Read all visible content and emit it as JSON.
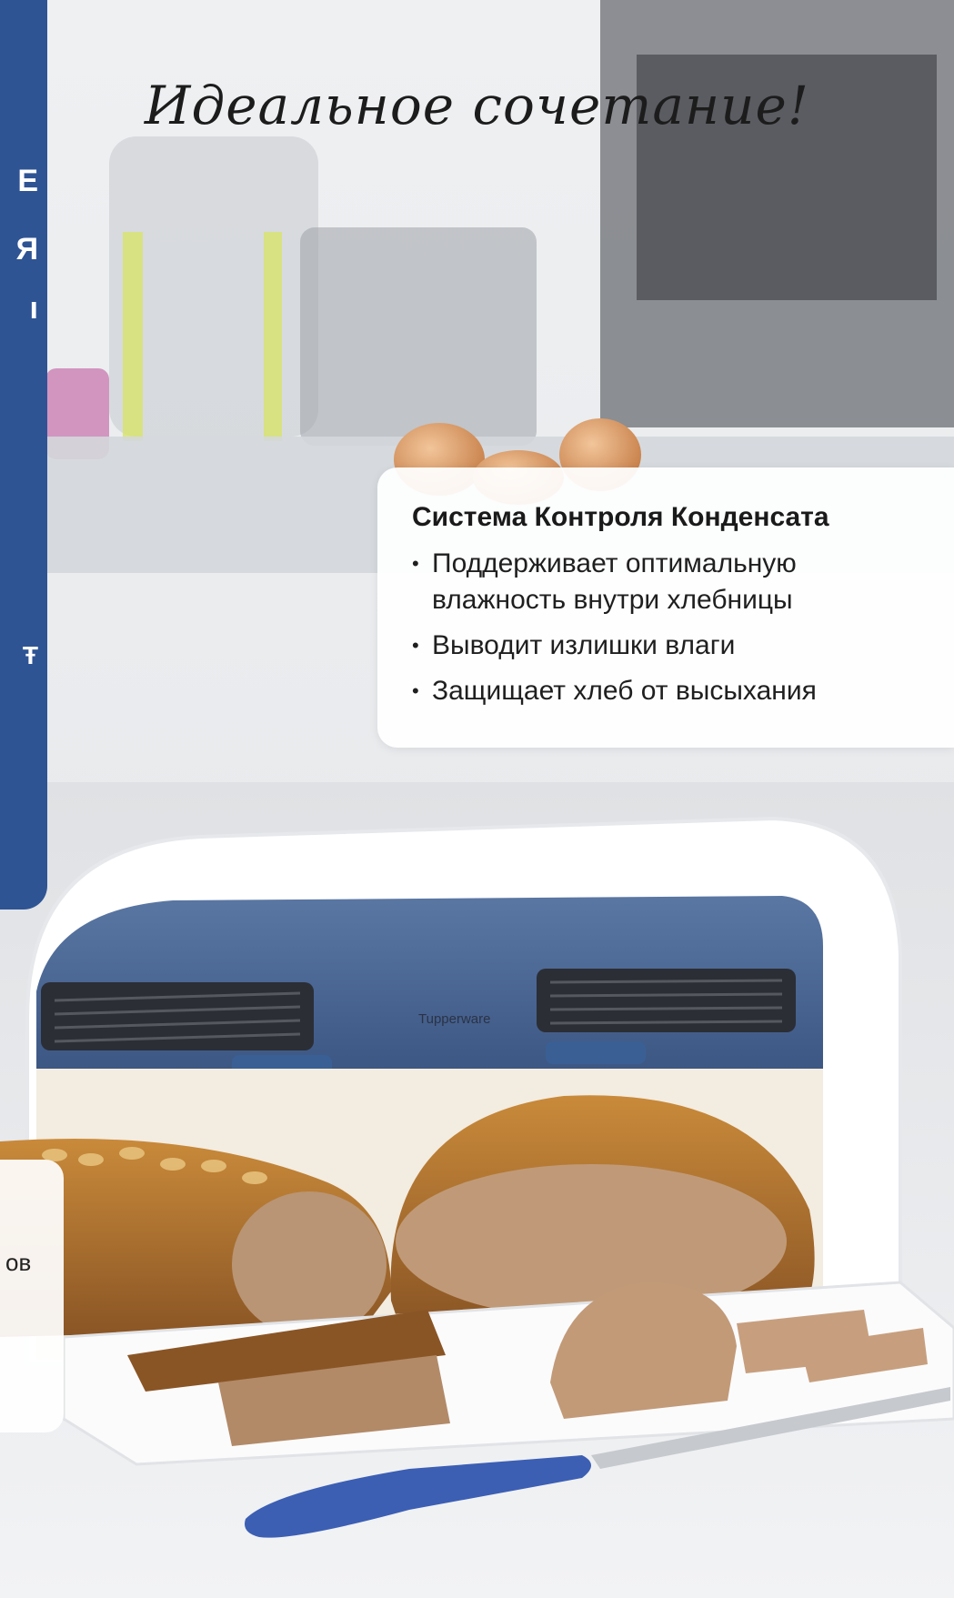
{
  "photo": {
    "script_title": "Идеальное сочетание!",
    "brand_mark": "Tupperware"
  },
  "side_banner": {
    "fragments": [
      "E",
      "Я",
      "ı",
      "Ŧ"
    ]
  },
  "feature_card": {
    "heading": "Система Контроля Конденсата",
    "bullets": [
      "Поддерживает оптимальную влажность внутри хлебницы",
      "Выводит излишки влаги",
      "Защищает хлеб от высыхания"
    ]
  },
  "bottom_card": {
    "fragment": "ов"
  },
  "colors": {
    "banner_blue": "#2f5494",
    "breadbox_blue": "#4e6a92",
    "knife_handle": "#3c5fb4"
  }
}
